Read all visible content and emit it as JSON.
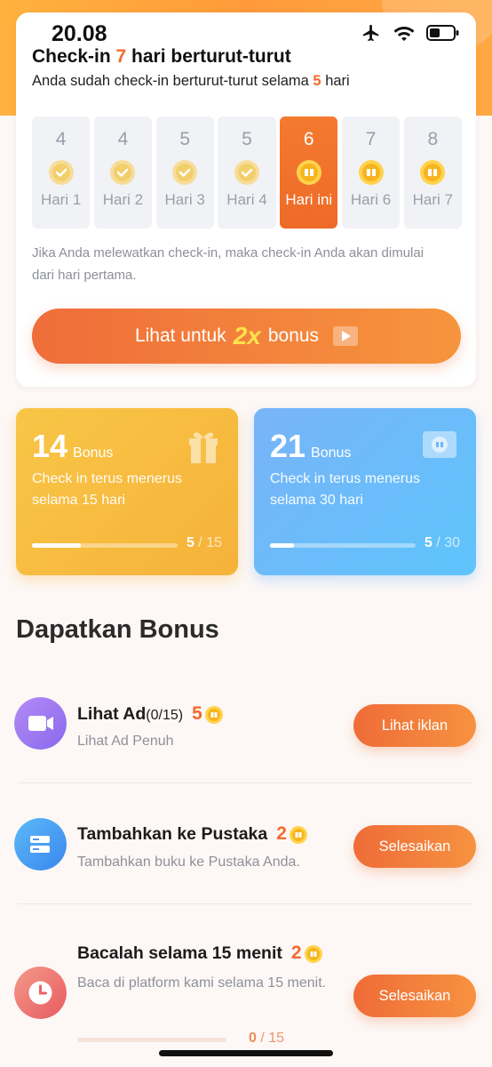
{
  "status_bar": {
    "time": "20.08"
  },
  "checkin": {
    "title_pre": "Check-in ",
    "title_num": "7",
    "title_post": " hari berturut-turut",
    "sub_pre": "Anda sudah check-in berturut-turut selama ",
    "sub_num": "5",
    "sub_post": " hari",
    "days": [
      {
        "num": "4",
        "label": "Hari 1",
        "state": "done"
      },
      {
        "num": "4",
        "label": "Hari 2",
        "state": "done"
      },
      {
        "num": "5",
        "label": "Hari 3",
        "state": "done"
      },
      {
        "num": "5",
        "label": "Hari 4",
        "state": "done"
      },
      {
        "num": "6",
        "label": "Hari ini",
        "state": "today"
      },
      {
        "num": "7",
        "label": "Hari 6",
        "state": "pending"
      },
      {
        "num": "8",
        "label": "Hari 7",
        "state": "pending"
      }
    ],
    "note": "Jika Anda melewatkan check-in, maka check-in Anda akan dimulai dari hari pertama.",
    "bonus_button": {
      "pre": "Lihat untuk ",
      "multiplier": "2x",
      "post": " bonus"
    }
  },
  "streak_cards": [
    {
      "value": "14",
      "unit": "Bonus",
      "desc": "Check in terus menerus selama 15 hari",
      "current": "5",
      "total": "15",
      "progress": 0.333
    },
    {
      "value": "21",
      "unit": "Bonus",
      "desc": "Check in terus menerus selama 30 hari",
      "current": "5",
      "total": "30",
      "progress": 0.167
    }
  ],
  "section_title": "Dapatkan Bonus",
  "tasks": [
    {
      "name": "Lihat Ad",
      "progress": "(0/15)",
      "reward": "5",
      "desc": "Lihat Ad Penuh",
      "button": "Lihat iklan"
    },
    {
      "name": "Tambahkan ke Pustaka",
      "progress": "",
      "reward": "2",
      "desc": "Tambahkan buku ke Pustaka Anda.",
      "button": "Selesaikan"
    },
    {
      "name": "Bacalah selama 15 menit",
      "progress": "",
      "reward": "2",
      "desc": "Baca di platform kami selama 15 menit.",
      "button": "Selesaikan",
      "current": "0",
      "total": "15",
      "bar_progress": 0
    }
  ],
  "colors": {
    "accent": "#f26a2e",
    "yellow": "#f7bd40",
    "blue": "#6dbaf9"
  }
}
